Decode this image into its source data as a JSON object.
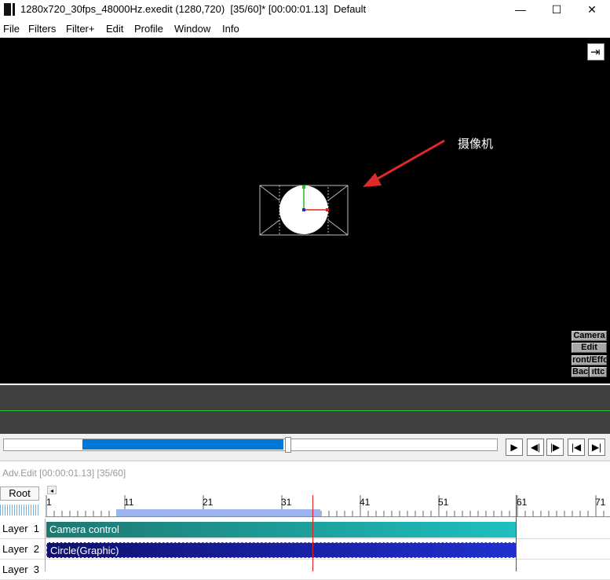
{
  "window": {
    "title": "1280x720_30fps_48000Hz.exedit (1280,720)  [35/60]* [00:00:01.13]  Default",
    "minimize_glyph": "—",
    "maximize_glyph": "☐",
    "close_glyph": "✕"
  },
  "menu": {
    "items": [
      "File",
      "Filters",
      "Filter+",
      "Edit",
      "Profile",
      "Window",
      "Info"
    ]
  },
  "preview": {
    "annotation": "摄像机",
    "dock_glyph": "⇥",
    "side_buttons": [
      "Camera",
      "Edit",
      "ront/Effo",
      "Back",
      "ıttc"
    ]
  },
  "playback": {
    "play_glyph": "▶",
    "prev_frame_glyph": "◀|",
    "next_frame_glyph": "|▶",
    "start_glyph": "|◀",
    "end_glyph": "▶|"
  },
  "advedit": {
    "title": "Adv.Edit [00:00:01.13] [35/60]"
  },
  "timeline": {
    "root_label": "Root",
    "scroll_glyph": "◂",
    "ticks": [
      "1",
      "11",
      "21",
      "31",
      "41",
      "51",
      "61",
      "71"
    ],
    "layers": [
      {
        "label": "Layer  1",
        "clip": "Camera control"
      },
      {
        "label": "Layer  2",
        "clip": "Circle(Graphic)"
      },
      {
        "label": "Layer  3",
        "clip": ""
      }
    ]
  },
  "colors": {
    "accent": "#0078d7",
    "camera_clip": "#1e7870",
    "circle_clip": "#2030d0",
    "cursor": "#e02020"
  }
}
